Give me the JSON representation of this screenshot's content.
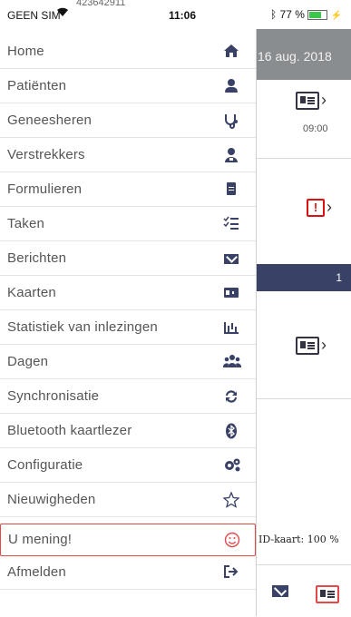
{
  "status_bar": {
    "carrier": "GEEN SIM",
    "wifi_icon": "wifi-icon",
    "overline": "423642911",
    "time": "11:06",
    "bluetooth_icon": "bluetooth-icon",
    "battery": "77 %"
  },
  "background_app": {
    "date": "16 aug. 2018",
    "time_1": "09:00",
    "count_badge": "1",
    "id_card_status": "ID-kaart: 100 %"
  },
  "menu": {
    "items": [
      {
        "label": "Home",
        "icon": "home-icon",
        "glyph": "🏠"
      },
      {
        "label": "Patiënten",
        "icon": "person-icon",
        "glyph": ""
      },
      {
        "label": "Geneesheren",
        "icon": "stethoscope-icon",
        "glyph": "⚕"
      },
      {
        "label": "Verstrekkers",
        "icon": "provider-icon",
        "glyph": "👤"
      },
      {
        "label": "Formulieren",
        "icon": "document-icon",
        "glyph": ""
      },
      {
        "label": "Taken",
        "icon": "task-list-icon",
        "glyph": "☰"
      },
      {
        "label": "Berichten",
        "icon": "envelope-icon",
        "glyph": ""
      },
      {
        "label": "Kaarten",
        "icon": "id-card-icon",
        "glyph": ""
      },
      {
        "label": "Statistiek van inlezingen",
        "icon": "bar-chart-icon",
        "glyph": ""
      },
      {
        "label": "Dagen",
        "icon": "users-icon",
        "glyph": "👥"
      },
      {
        "label": "Synchronisatie",
        "icon": "sync-icon",
        "glyph": "⟳"
      },
      {
        "label": "Bluetooth kaartlezer",
        "icon": "bluetooth-icon",
        "glyph": "ᛒ"
      },
      {
        "label": "Configuratie",
        "icon": "gears-icon",
        "glyph": "⚙"
      },
      {
        "label": "Nieuwigheden",
        "icon": "star-icon",
        "glyph": "☆"
      },
      {
        "label": "U mening!",
        "icon": "smiley-icon",
        "glyph": "☺"
      },
      {
        "label": "Afmelden",
        "icon": "sign-out-icon",
        "glyph": "↦"
      }
    ]
  },
  "colors": {
    "accent": "#394266",
    "highlight_border": "#e24a4a",
    "date_bar": "#8a8d90",
    "warning": "#dd1111"
  }
}
